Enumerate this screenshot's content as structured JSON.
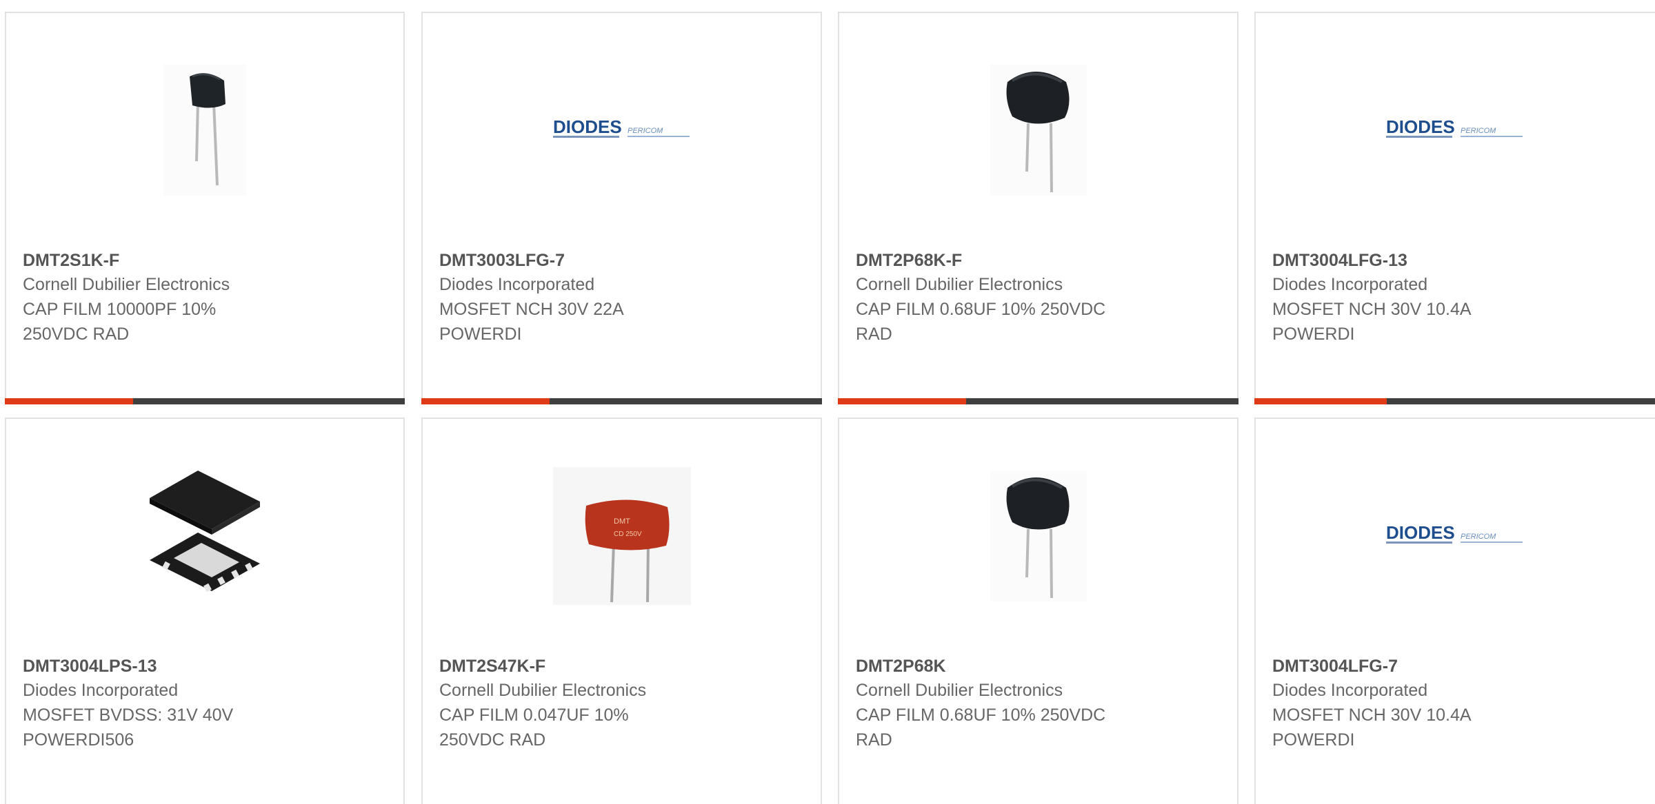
{
  "cards": [
    {
      "part": "DMT2S1K-F",
      "mfr": "Cornell Dubilier Electronics",
      "desc": "CAP FILM 10000PF 10%\n250VDC RAD",
      "image": "capacitor-small-icon",
      "progress": 0.32
    },
    {
      "part": "DMT3003LFG-7",
      "mfr": "Diodes Incorporated",
      "desc": "MOSFET NCH 30V 22A\nPOWERDI",
      "image": "diodes-logo",
      "progress": 0.32
    },
    {
      "part": "DMT2P68K-F",
      "mfr": "Cornell Dubilier Electronics",
      "desc": "CAP FILM 0.68UF 10% 250VDC\nRAD",
      "image": "capacitor-large-icon",
      "progress": 0.32
    },
    {
      "part": "DMT3004LFG-13",
      "mfr": "Diodes Incorporated",
      "desc": "MOSFET NCH 30V 10.4A\nPOWERDI",
      "image": "diodes-logo",
      "progress": 0.32
    },
    {
      "part": "DMT3004LPS-13",
      "mfr": "Diodes Incorporated",
      "desc": "MOSFET BVDSS: 31V 40V\nPOWERDI506",
      "image": "powerdi-package-icon"
    },
    {
      "part": "DMT2S47K-F",
      "mfr": "Cornell Dubilier Electronics",
      "desc": "CAP FILM 0.047UF 10%\n250VDC RAD",
      "image": "red-capacitor-icon"
    },
    {
      "part": "DMT2P68K",
      "mfr": "Cornell Dubilier Electronics",
      "desc": "CAP FILM 0.68UF 10% 250VDC\nRAD",
      "image": "capacitor-large-icon"
    },
    {
      "part": "DMT3004LFG-7",
      "mfr": "Diodes Incorporated",
      "desc": "MOSFET NCH 30V 10.4A\nPOWERDI",
      "image": "diodes-logo"
    }
  ],
  "logo": {
    "brand": "DIODES",
    "sub": "PERICOM"
  },
  "red_cap_marking": {
    "line1": "DMT",
    "line2": "CD 250V"
  },
  "colors": {
    "accent": "#e03a17",
    "track": "#3f3f3f",
    "border": "#e2e2e2",
    "title": "#555555",
    "text": "#666666"
  }
}
